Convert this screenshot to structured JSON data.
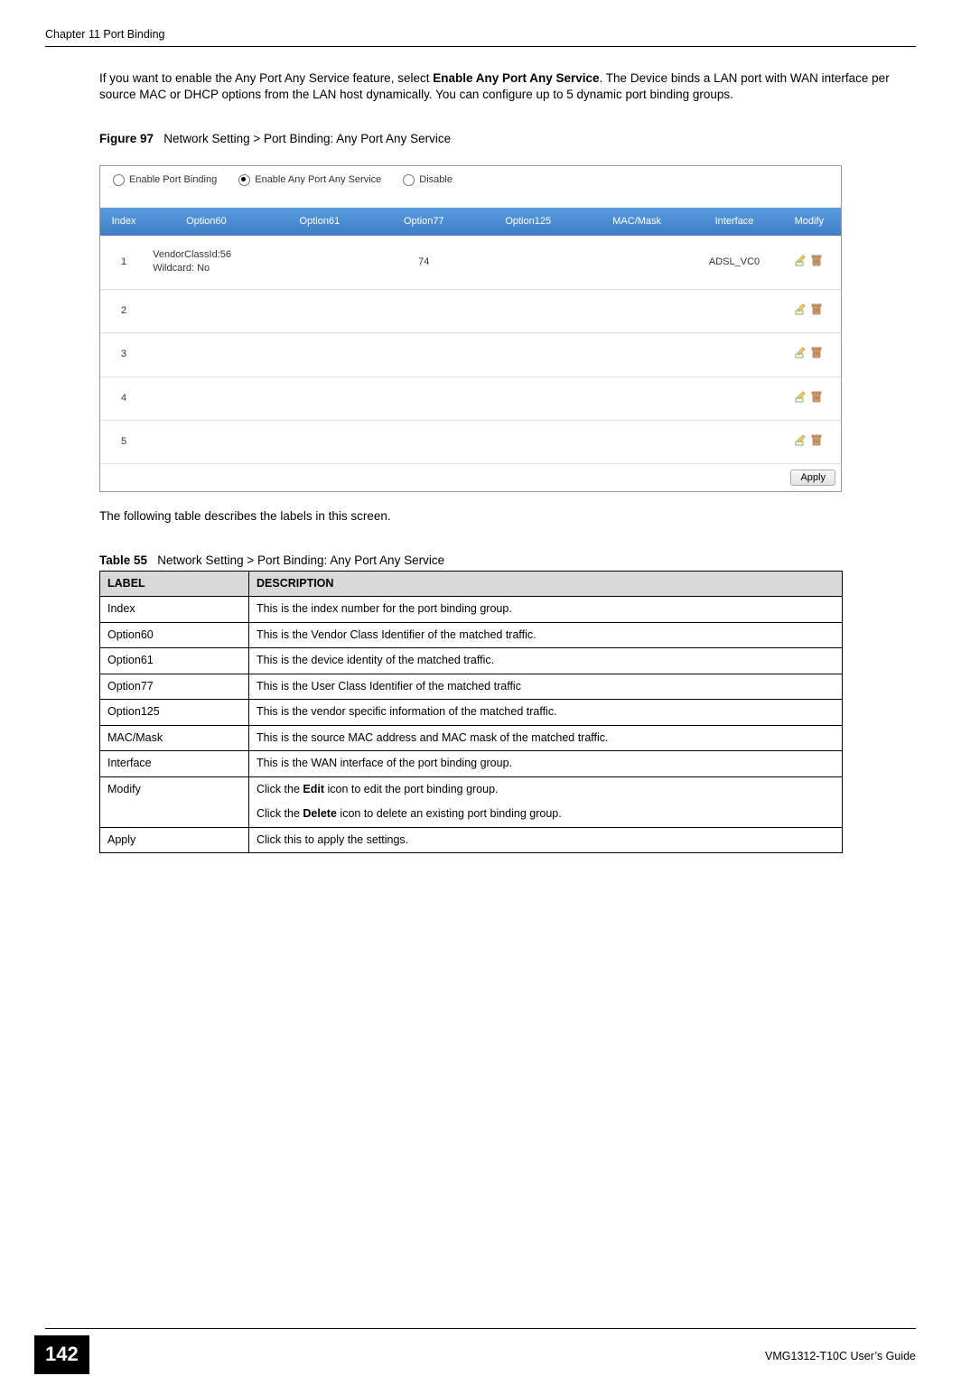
{
  "header": {
    "chapter": "Chapter 11 Port Binding"
  },
  "intro": {
    "pre": "If you want to enable the Any Port Any Service feature, select ",
    "bold": "Enable Any Port Any Service",
    "post": ". The Device binds a LAN port with WAN interface per source MAC or DHCP options from the LAN host dynamically. You can configure up to 5 dynamic port binding groups."
  },
  "figure": {
    "label_prefix": "Figure 97",
    "label_text": "Network Setting > Port Binding: Any Port Any Service"
  },
  "screenshot": {
    "radios": {
      "r1": "Enable Port Binding",
      "r2": "Enable Any Port Any Service",
      "r3": "Disable",
      "selected": "r2"
    },
    "columns": {
      "index": "Index",
      "o60": "Option60",
      "o61": "Option61",
      "o77": "Option77",
      "o125": "Option125",
      "mac": "MAC/Mask",
      "ifc": "Interface",
      "mod": "Modify"
    },
    "rows": [
      {
        "index": "1",
        "o60": "VendorClassId:56\nWildcard: No",
        "o61": "",
        "o77": "74",
        "o125": "",
        "mac": "",
        "ifc": "ADSL_VC0"
      },
      {
        "index": "2",
        "o60": "",
        "o61": "",
        "o77": "",
        "o125": "",
        "mac": "",
        "ifc": ""
      },
      {
        "index": "3",
        "o60": "",
        "o61": "",
        "o77": "",
        "o125": "",
        "mac": "",
        "ifc": ""
      },
      {
        "index": "4",
        "o60": "",
        "o61": "",
        "o77": "",
        "o125": "",
        "mac": "",
        "ifc": ""
      },
      {
        "index": "5",
        "o60": "",
        "o61": "",
        "o77": "",
        "o125": "",
        "mac": "",
        "ifc": ""
      }
    ],
    "apply": "Apply"
  },
  "mid_text": "The following table describes the labels in this screen.",
  "table_caption": {
    "prefix": "Table 55",
    "text": "Network Setting > Port Binding: Any Port Any Service"
  },
  "desc_table": {
    "head_label": "LABEL",
    "head_desc": "DESCRIPTION",
    "rows": [
      {
        "label": "Index",
        "desc": "This is the index number for the port binding group."
      },
      {
        "label": "Option60",
        "desc": "This is the Vendor Class Identifier of the matched traffic."
      },
      {
        "label": "Option61",
        "desc": "This is the device identity of the matched traffic."
      },
      {
        "label": "Option77",
        "desc": "This is the User Class Identifier of the matched traffic"
      },
      {
        "label": "Option125",
        "desc": "This is the vendor specific information of the matched traffic."
      },
      {
        "label": "MAC/Mask",
        "desc": "This is the source MAC address and MAC mask of the matched traffic."
      },
      {
        "label": "Interface",
        "desc": "This is the WAN interface of the port binding group."
      }
    ],
    "modify": {
      "label": "Modify",
      "p1_pre": "Click the ",
      "p1_bold": "Edit",
      "p1_post": " icon to edit the port binding group.",
      "p2_pre": "Click the ",
      "p2_bold": "Delete",
      "p2_post": " icon to delete an existing port binding group."
    },
    "apply_row": {
      "label": "Apply",
      "desc": "Click this to apply the settings."
    }
  },
  "footer": {
    "page_number": "142",
    "guide": "VMG1312-T10C User’s Guide"
  }
}
